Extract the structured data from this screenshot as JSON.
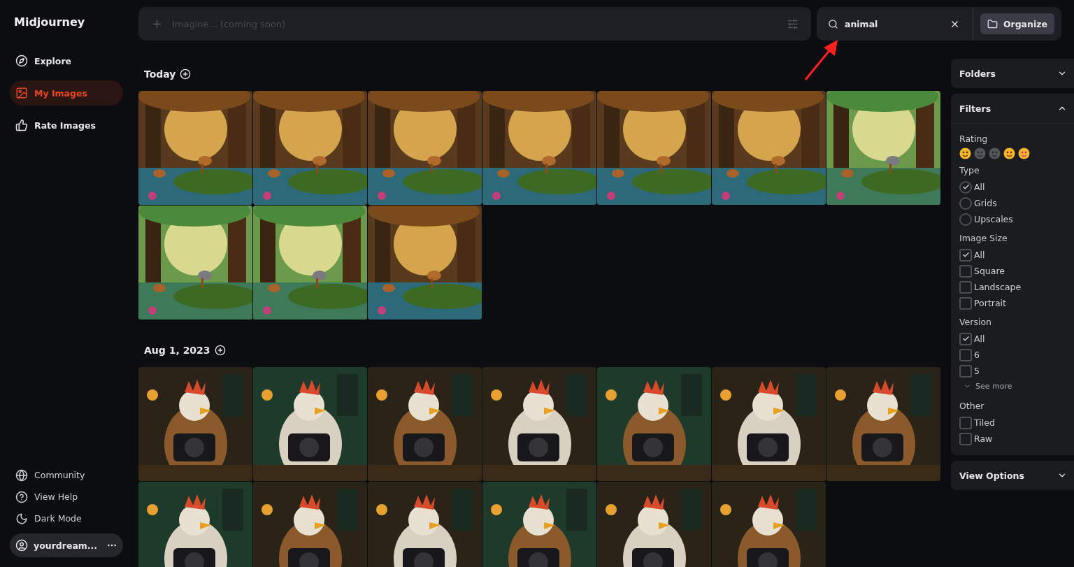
{
  "app": {
    "name": "Midjourney"
  },
  "sidebar": {
    "items": [
      {
        "label": "Explore",
        "selected": false
      },
      {
        "label": "My Images",
        "selected": true
      },
      {
        "label": "Rate Images",
        "selected": false
      }
    ],
    "footer_items": [
      {
        "label": "Community"
      },
      {
        "label": "View Help"
      },
      {
        "label": "Dark Mode"
      }
    ],
    "user": {
      "name": "yourdream..."
    }
  },
  "prompt": {
    "placeholder": "Imagine... (coming soon)"
  },
  "search": {
    "value": "animal"
  },
  "organize_button": "Organize",
  "groups": [
    {
      "date": "Today"
    },
    {
      "date": "Aug 1, 2023"
    }
  ],
  "panels": {
    "folders": {
      "title": "Folders",
      "expanded": false
    },
    "filters": {
      "title": "Filters",
      "expanded": true,
      "sections": [
        {
          "title": "Rating",
          "kind": "rating"
        },
        {
          "title": "Type",
          "kind": "radio",
          "options": [
            {
              "label": "All",
              "checked": true
            },
            {
              "label": "Grids",
              "checked": false
            },
            {
              "label": "Upscales",
              "checked": false
            }
          ]
        },
        {
          "title": "Image Size",
          "kind": "checkbox",
          "options": [
            {
              "label": "All",
              "checked": true
            },
            {
              "label": "Square",
              "checked": false
            },
            {
              "label": "Landscape",
              "checked": false
            },
            {
              "label": "Portrait",
              "checked": false
            }
          ]
        },
        {
          "title": "Version",
          "kind": "checkbox",
          "options": [
            {
              "label": "All",
              "checked": true
            },
            {
              "label": "6",
              "checked": false
            },
            {
              "label": "5",
              "checked": false
            }
          ],
          "more_link": "See more"
        },
        {
          "title": "Other",
          "kind": "checkbox",
          "options": [
            {
              "label": "Tiled",
              "checked": false
            },
            {
              "label": "Raw",
              "checked": false
            }
          ]
        }
      ]
    },
    "view_options": {
      "title": "View Options",
      "expanded": false
    }
  }
}
